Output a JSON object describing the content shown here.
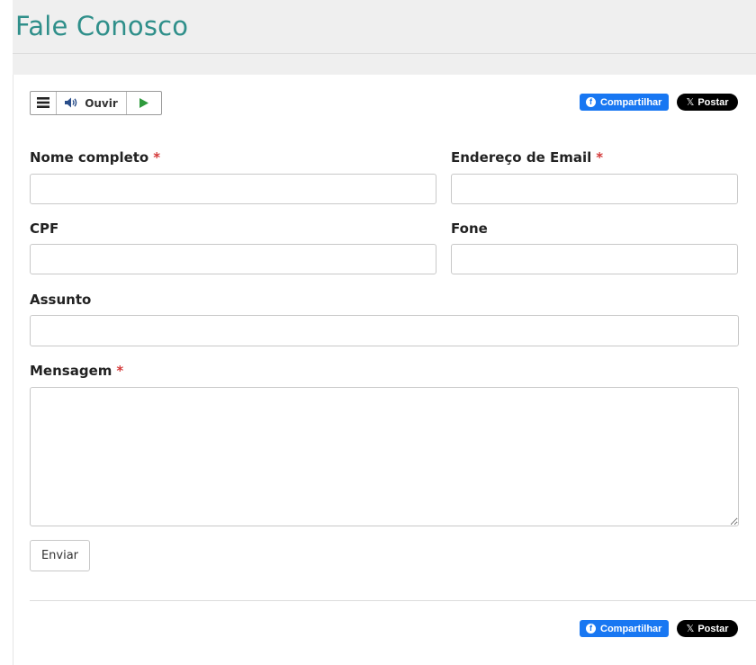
{
  "page": {
    "title": "Fale Conosco",
    "title_color": "#2f8f8a"
  },
  "accessibility_toolbar": {
    "menu_icon": "hamburger-menu-icon",
    "speaker_icon": "speaker-icon",
    "listen_label": "Ouvir",
    "play_icon": "play-icon",
    "play_color": "#2e9a3c"
  },
  "share": {
    "facebook_label": "Compartilhar",
    "facebook_color": "#1877f2",
    "x_label": "Postar",
    "x_icon": "x-logo-icon"
  },
  "form": {
    "required_marker": "*",
    "fields": {
      "full_name": {
        "label": "Nome completo",
        "value": ""
      },
      "email": {
        "label": "Endereço de Email",
        "value": ""
      },
      "cpf": {
        "label": "CPF",
        "value": ""
      },
      "phone": {
        "label": "Fone",
        "value": ""
      },
      "subject": {
        "label": "Assunto",
        "value": ""
      },
      "message": {
        "label": "Mensagem",
        "value": ""
      }
    },
    "submit_label": "Enviar"
  }
}
